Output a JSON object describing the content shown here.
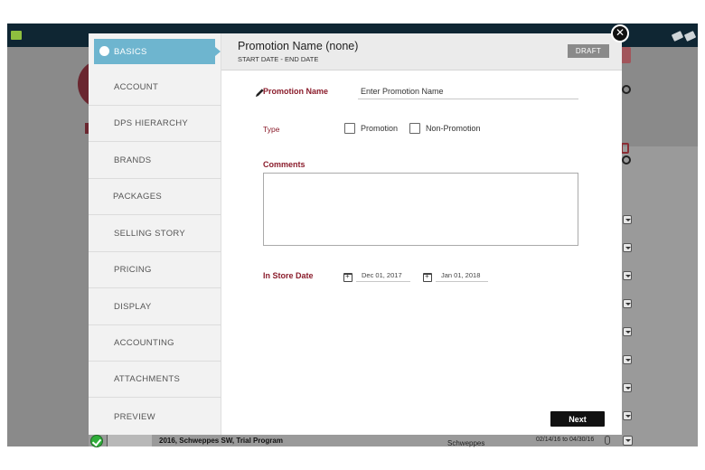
{
  "background_app": {
    "bottom_row": {
      "title": "2016, Schweppes SW, Trial Program",
      "brand": "Schweppes",
      "dates": "02/14/16 to 04/30/16"
    }
  },
  "modal": {
    "header": {
      "title": "Promotion Name (none)",
      "subtitle": "START DATE - END DATE",
      "status_badge": "DRAFT"
    },
    "sidebar": {
      "items": [
        {
          "label": "BASICS",
          "active": true
        },
        {
          "label": "ACCOUNT"
        },
        {
          "label": "DPS HIERARCHY"
        },
        {
          "label": "BRANDS"
        },
        {
          "label": "PACKAGES"
        },
        {
          "label": "SELLING STORY"
        },
        {
          "label": "PRICING"
        },
        {
          "label": "DISPLAY"
        },
        {
          "label": "ACCOUNTING"
        },
        {
          "label": "ATTACHMENTS"
        },
        {
          "label": "PREVIEW"
        }
      ]
    },
    "form": {
      "promotion_name_label": "Promotion Name",
      "promotion_name_placeholder": "Enter Promotion Name",
      "type_label": "Type",
      "type_options": [
        "Promotion",
        "Non-Promotion"
      ],
      "comments_label": "Comments",
      "in_store_date_label": "In Store Date",
      "start_date": "Dec 01, 2017",
      "end_date": "Jan 01, 2018"
    },
    "next_label": "Next"
  },
  "icons": [
    "close-icon",
    "pencil-icon",
    "calendar-icon",
    "check-icon",
    "paperclip-icon",
    "search-icon"
  ],
  "colors": {
    "active_nav": "#6eb5cf",
    "label_red": "#8b1d2c",
    "draft_badge": "#8a8a8a",
    "next_button": "#111111"
  }
}
